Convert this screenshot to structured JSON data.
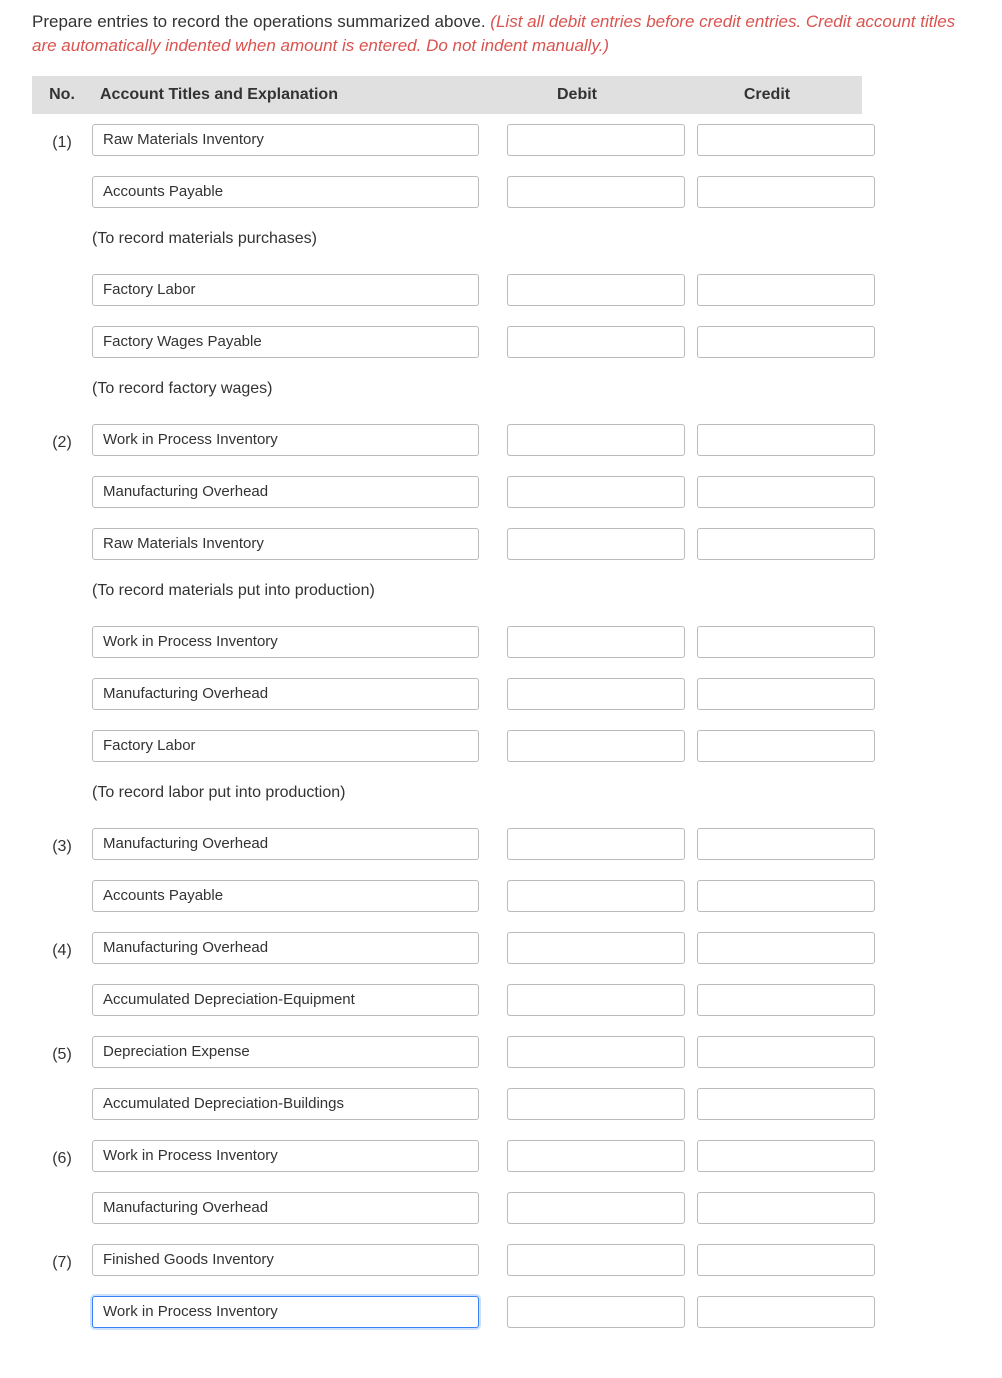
{
  "instructions": {
    "text": "Prepare entries to record the operations summarized above. ",
    "hint": "(List all debit entries before credit entries. Credit account titles are automatically indented when amount is entered. Do not indent manually.)"
  },
  "headers": {
    "no": "No.",
    "title": "Account Titles and Explanation",
    "debit": "Debit",
    "credit": "Credit"
  },
  "rows": [
    {
      "no": "(1)",
      "account": "Raw Materials Inventory",
      "debit": "",
      "credit": ""
    },
    {
      "no": "",
      "account": "Accounts Payable",
      "debit": "",
      "credit": ""
    },
    {
      "explain": "(To record materials purchases)"
    },
    {
      "no": "",
      "account": "Factory Labor",
      "debit": "",
      "credit": ""
    },
    {
      "no": "",
      "account": "Factory Wages Payable",
      "debit": "",
      "credit": ""
    },
    {
      "explain": "(To record factory wages)"
    },
    {
      "no": "(2)",
      "account": "Work in Process Inventory",
      "debit": "",
      "credit": ""
    },
    {
      "no": "",
      "account": "Manufacturing Overhead",
      "debit": "",
      "credit": ""
    },
    {
      "no": "",
      "account": "Raw Materials Inventory",
      "debit": "",
      "credit": ""
    },
    {
      "explain": "(To record materials put into production)"
    },
    {
      "no": "",
      "account": "Work in Process Inventory",
      "debit": "",
      "credit": ""
    },
    {
      "no": "",
      "account": "Manufacturing Overhead",
      "debit": "",
      "credit": ""
    },
    {
      "no": "",
      "account": "Factory Labor",
      "debit": "",
      "credit": ""
    },
    {
      "explain": "(To record labor put into production)"
    },
    {
      "no": "(3)",
      "account": "Manufacturing Overhead",
      "debit": "",
      "credit": ""
    },
    {
      "no": "",
      "account": "Accounts Payable",
      "debit": "",
      "credit": ""
    },
    {
      "no": "(4)",
      "account": "Manufacturing Overhead",
      "debit": "",
      "credit": ""
    },
    {
      "no": "",
      "account": "Accumulated Depreciation-Equipment",
      "debit": "",
      "credit": ""
    },
    {
      "no": "(5)",
      "account": "Depreciation Expense",
      "debit": "",
      "credit": ""
    },
    {
      "no": "",
      "account": "Accumulated Depreciation-Buildings",
      "debit": "",
      "credit": ""
    },
    {
      "no": "(6)",
      "account": "Work in Process Inventory",
      "debit": "",
      "credit": ""
    },
    {
      "no": "",
      "account": "Manufacturing Overhead",
      "debit": "",
      "credit": ""
    },
    {
      "no": "(7)",
      "account": "Finished Goods Inventory",
      "debit": "",
      "credit": ""
    },
    {
      "no": "",
      "account": "Work in Process Inventory",
      "debit": "",
      "credit": "",
      "focused": true
    }
  ]
}
